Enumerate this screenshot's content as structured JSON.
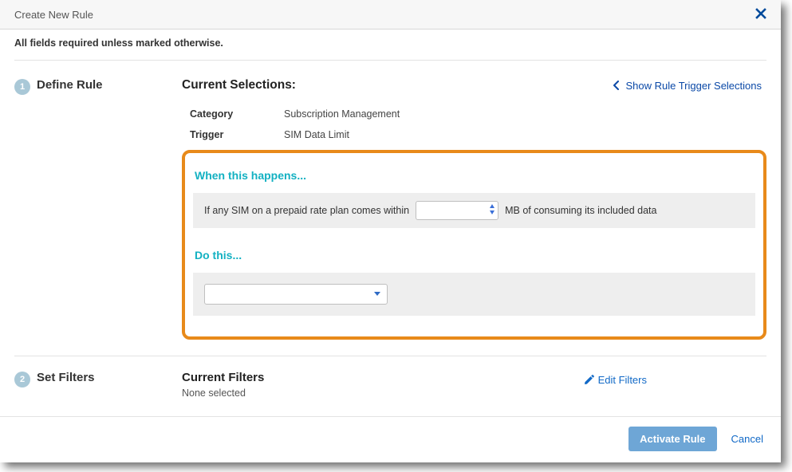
{
  "header": {
    "title": "Create New Rule"
  },
  "required_note": "All fields required unless marked otherwise.",
  "step1": {
    "number": "1",
    "title": "Define Rule",
    "selections_title": "Current Selections:",
    "show_trigger_label": "Show Rule Trigger Selections",
    "category_label": "Category",
    "category_value": "Subscription Management",
    "trigger_label": "Trigger",
    "trigger_value": "SIM Data Limit",
    "when_heading": "When this happens...",
    "condition_prefix": "If any SIM on a prepaid rate plan comes within",
    "condition_input_value": "",
    "condition_suffix": "MB of consuming its included data",
    "do_heading": "Do this...",
    "action_value": ""
  },
  "step2": {
    "number": "2",
    "title": "Set Filters",
    "filters_title": "Current Filters",
    "filters_none": "None selected",
    "edit_filters_label": "Edit Filters"
  },
  "footer": {
    "activate": "Activate Rule",
    "cancel": "Cancel"
  }
}
